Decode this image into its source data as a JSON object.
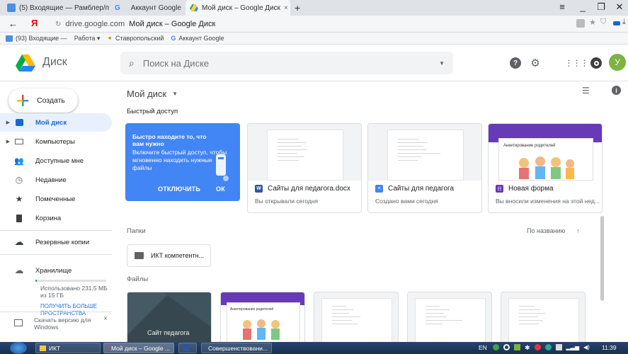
{
  "browser": {
    "tabs": [
      {
        "label": "(5) Входящие — Рамблер/п",
        "active": false
      },
      {
        "label": "Аккаунт Google",
        "active": false
      },
      {
        "label": "Мой диск – Google Диск",
        "active": true
      }
    ],
    "new_tab": "+",
    "yandex_logo": "Я",
    "url_domain": "drive.google.com",
    "url_title": "Мой диск – Google Диск",
    "bookmarks": [
      "(93) Входящие —",
      "Работа ▾",
      "Ставропольский",
      "Аккаунт Google"
    ]
  },
  "header": {
    "logo_text": "Диск",
    "search_placeholder": "Поиск на Диске",
    "avatar_letter": "У"
  },
  "sidebar": {
    "create_label": "Создать",
    "items": [
      {
        "label": "Мой диск",
        "active": true
      },
      {
        "label": "Компьютеры"
      },
      {
        "label": "Доступные мне"
      },
      {
        "label": "Недавние"
      },
      {
        "label": "Помеченные"
      },
      {
        "label": "Корзина"
      },
      {
        "label": "Резервные копии"
      }
    ],
    "storage_label": "Хранилище",
    "storage_used": "Использовано 231,5 МБ из 15 ГБ",
    "storage_used_fraction": 0.015,
    "storage_upgrade": "ПОЛУЧИТЬ БОЛЬШЕ ПРОСТРАНСТВА",
    "download_label": "Скачать версию для Windows",
    "close_glyph": "×"
  },
  "main": {
    "title": "Мой диск",
    "quick_access_label": "Быстрый доступ",
    "promo": {
      "title": "Быстро находите то, что вам нужно",
      "text": "Включите быстрый доступ, чтобы мгновенно находить нужные файлы",
      "disable_label": "ОТКЛЮЧИТЬ",
      "ok_label": "ОК"
    },
    "quick_cards": [
      {
        "name": "Сайты для педагога.docx",
        "subtitle": "Вы открывали сегодня",
        "icon_letter": "W"
      },
      {
        "name": "Сайты для педагога",
        "subtitle": "Создано вами сегодня",
        "icon_letter": "≡"
      },
      {
        "name": "Новая форма",
        "subtitle": "Вы вносили изменения на этой нед...",
        "icon_letter": "☷",
        "thumb_title": "Анкетирование родителей"
      }
    ],
    "folders_label": "Папки",
    "sort_label": "По названию",
    "sort_arrow": "↑",
    "folders": [
      {
        "name": "ИКТ компетентн..."
      }
    ],
    "files_label": "Файлы",
    "files": [
      {
        "thumb_title": "Сайт педагога"
      },
      {
        "thumb_title": "Анкетирование родителей"
      },
      {},
      {},
      {}
    ]
  },
  "taskbar": {
    "buttons": [
      "ИКТ",
      "Мой диск – Google ...",
      "Совершенствовани..."
    ],
    "lang": "EN",
    "time": "11:39"
  },
  "colors": {
    "accent_blue": "#4285f4",
    "active_nav_bg": "#e8f0fe",
    "active_nav_text": "#1967d2",
    "form_purple": "#673ab7",
    "avatar_green": "#7cb342"
  }
}
